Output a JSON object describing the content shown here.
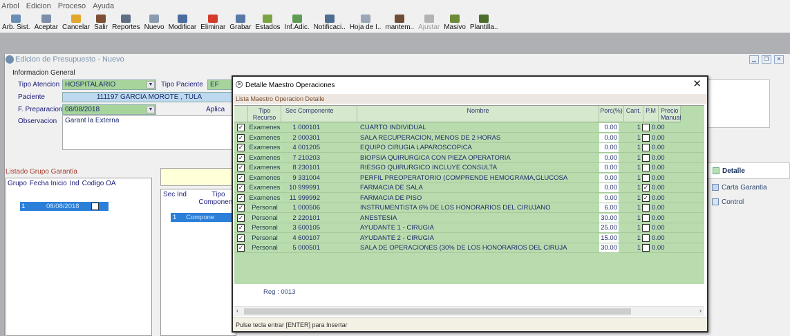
{
  "menu": [
    "Arbol",
    "Edicion",
    "Proceso",
    "Ayuda"
  ],
  "toolbar": [
    {
      "label": "Arb. Sist.",
      "icon": "tree-icon",
      "color": "#6b8fb4",
      "enabled": true
    },
    {
      "label": "Aceptar",
      "icon": "grid-icon",
      "color": "#7d8ea8",
      "enabled": true
    },
    {
      "label": "Cancelar",
      "icon": "cancel-icon",
      "color": "#e0a72a",
      "enabled": true
    },
    {
      "label": "Salir",
      "icon": "exit-door-icon",
      "color": "#7c4f34",
      "enabled": true
    },
    {
      "label": "Reportes",
      "icon": "report-icon",
      "color": "#5e6f84",
      "enabled": true
    },
    {
      "label": "Nuevo",
      "icon": "new-document-icon",
      "color": "#8b9bb0",
      "enabled": true
    },
    {
      "label": "Modificar",
      "icon": "edit-icon",
      "color": "#4a6da0",
      "enabled": true
    },
    {
      "label": "Eliminar",
      "icon": "delete-icon",
      "color": "#d53a2a",
      "enabled": true
    },
    {
      "label": "Grabar",
      "icon": "save-disk-icon",
      "color": "#5878a8",
      "enabled": true
    },
    {
      "label": "Estados",
      "icon": "bar-chart-icon",
      "color": "#7aa442",
      "enabled": true
    },
    {
      "label": "Inf.Adic.",
      "icon": "info-icon",
      "color": "#5e9b54",
      "enabled": true
    },
    {
      "label": "Notificaci..",
      "icon": "notification-icon",
      "color": "#4f6d93",
      "enabled": true
    },
    {
      "label": "Hoja de I..",
      "icon": "sheet-icon",
      "color": "#9aa7b8",
      "enabled": true
    },
    {
      "label": "mantem..",
      "icon": "maintenance-icon",
      "color": "#6f4c35",
      "enabled": true
    },
    {
      "label": "Ajustar",
      "icon": "adjust-icon",
      "color": "#b3b3b3",
      "enabled": false
    },
    {
      "label": "Masivo",
      "icon": "bulk-icon",
      "color": "#6c8a3a",
      "enabled": true
    },
    {
      "label": "Plantilla..",
      "icon": "template-icon",
      "color": "#4e6c2d",
      "enabled": true
    }
  ],
  "child_window": {
    "title": "Edicion de Presupuesto - Nuevo"
  },
  "form": {
    "section": "Informacion General",
    "tipo_atencion_label": "Tipo Atencion",
    "tipo_atencion_value": "HOSPITALARIO",
    "tipo_paciente_label": "Tipo Paciente",
    "tipo_paciente_value": "EF",
    "paciente_label": "Paciente",
    "paciente_id": "111197",
    "paciente_name": "GARCIA MOROTE , TULA",
    "f_prep_label": "F. Preparacion",
    "f_prep_value": "08/08/2018",
    "aplica_label": "Aplica",
    "obs_label": "Observacion",
    "obs_value": "Garant la Externa"
  },
  "listado": {
    "title": "Listado Grupo Garantia",
    "columns": [
      "Grupo",
      "Fecha Inicio",
      "Ind",
      "Codigo OA"
    ],
    "row": {
      "grupo": "1",
      "fecha": "08/08/2018"
    }
  },
  "mid": {
    "columns": [
      "Sec Ind",
      "Tipo Componente"
    ],
    "row": {
      "sec": "1",
      "tipo": "Compone"
    }
  },
  "tabs": [
    {
      "label": "Detalle",
      "icon": "detail-icon",
      "active": true
    },
    {
      "label": "Carta Garantia",
      "icon": "letter-icon",
      "active": false
    },
    {
      "label": "Control",
      "icon": "control-icon",
      "active": false
    }
  ],
  "modal": {
    "title": "Detalle Maestro Operaciones",
    "subtitle": "Lista Maestro Operacion Detalle",
    "columns": {
      "tipo": "Tipo Recurso",
      "sec": "Sec Componente",
      "nombre": "Nombre",
      "porc": "Porc(%)",
      "cant": "Cant.",
      "pm": "P.M",
      "precio": "Precio Manual"
    },
    "rows": [
      {
        "checked": true,
        "tipo": "Examenes",
        "sec": "1 000101",
        "nombre": "CUARTO INDIVIDUAL",
        "porc": "0.00",
        "cant": "1",
        "pm": false,
        "precio": "0.00"
      },
      {
        "checked": true,
        "tipo": "Examenes",
        "sec": "2 000301",
        "nombre": "SALA RECUPERACION, MENOS DE 2 HORAS",
        "porc": "0.00",
        "cant": "1",
        "pm": false,
        "precio": "0.00"
      },
      {
        "checked": true,
        "tipo": "Examenes",
        "sec": "4 001205",
        "nombre": "EQUIPO CIRUGIA LAPAROSCOPICA",
        "porc": "0.00",
        "cant": "1",
        "pm": false,
        "precio": "0.00"
      },
      {
        "checked": true,
        "tipo": "Examenes",
        "sec": "7 210203",
        "nombre": "BIOPSIA QUIRURGICA CON PIEZA OPERATORIA",
        "porc": "0.00",
        "cant": "1",
        "pm": false,
        "precio": "0.00"
      },
      {
        "checked": true,
        "tipo": "Examenes",
        "sec": "8 230101",
        "nombre": "RIESGO QUIRURGICO INCLUYE CONSULTA",
        "porc": "0.00",
        "cant": "1",
        "pm": false,
        "precio": "0.00"
      },
      {
        "checked": true,
        "tipo": "Examenes",
        "sec": "9 331004",
        "nombre": "PERFIL PREOPERATORIO (COMPRENDE HEMOGRAMA,GLUCOSA",
        "porc": "0.00",
        "cant": "1",
        "pm": false,
        "precio": "0.00"
      },
      {
        "checked": true,
        "tipo": "Examenes",
        "sec": "10 999991",
        "nombre": "FARMACIA DE SALA",
        "porc": "0.00",
        "cant": "1",
        "pm": true,
        "precio": "0.00"
      },
      {
        "checked": true,
        "tipo": "Examenes",
        "sec": "11 999992",
        "nombre": "FARMACIA DE PISO",
        "porc": "0.00",
        "cant": "1",
        "pm": true,
        "precio": "0.00"
      },
      {
        "checked": true,
        "tipo": "Personal",
        "sec": "1 000506",
        "nombre": "INSTRUMENTISTA 6% DE LOS HONORARIOS DEL CIRUJANO",
        "porc": "6.00",
        "cant": "1",
        "pm": false,
        "precio": "0.00"
      },
      {
        "checked": true,
        "tipo": "Personal",
        "sec": "2 220101",
        "nombre": "ANESTESIA",
        "porc": "30.00",
        "cant": "1",
        "pm": false,
        "precio": "0.00"
      },
      {
        "checked": true,
        "tipo": "Personal",
        "sec": "3 600105",
        "nombre": "AYUDANTE 1 - CIRUGIA",
        "porc": "25.00",
        "cant": "1",
        "pm": false,
        "precio": "0.00"
      },
      {
        "checked": true,
        "tipo": "Personal",
        "sec": "4 600107",
        "nombre": "AYUDANTE 2 - CIRUGIA",
        "porc": "15.00",
        "cant": "1",
        "pm": false,
        "precio": "0.00"
      },
      {
        "checked": true,
        "tipo": "Personal",
        "sec": "5 000501",
        "nombre": "SALA DE OPERACIONES (30% DE LOS HONORARIOS DEL CIRUJA",
        "porc": "30.00",
        "cant": "1",
        "pm": false,
        "precio": "0.00"
      }
    ],
    "reg_count": "Reg : 0013",
    "status": "Pulse tecla entrar [ENTER] para Insertar"
  }
}
